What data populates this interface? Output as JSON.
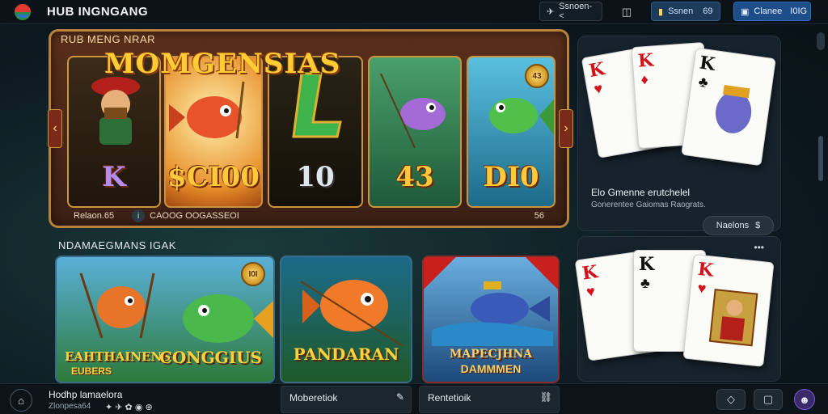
{
  "header": {
    "title": "HUB INGNGANG",
    "logo_icon": "colorful-ball-logo",
    "nav_button_1": "Ssnoen-<",
    "nav_button_2_label": "Ssnen",
    "nav_button_2_value": "69",
    "nav_button_3_label": "Clanee",
    "nav_button_3_value": "I0IG"
  },
  "featured": {
    "heading": "RUB MENG NRAR",
    "hero_title": "MOMGENSIAS",
    "reels": [
      {
        "label": "K",
        "art": "pirate-character"
      },
      {
        "label": "$CI00",
        "art": "red-fish-with-fork"
      },
      {
        "label": "10",
        "art": "green-letter-L"
      },
      {
        "label": "43",
        "art": "purple-fish-with-rod"
      },
      {
        "label": "DI0",
        "art": "green-fish-jumping"
      }
    ],
    "corner_coin": "43",
    "footer_left": "Relaon.65",
    "footer_mid": "CAOOG OOGASSEOI",
    "footer_right": "56"
  },
  "side_card_top": {
    "title": "Elo Gmenne erutchelel",
    "subtitle": "Gonerentee Gaiomas Raograts.",
    "button": "Naelons",
    "cards": [
      {
        "rank": "K",
        "suit": "♥",
        "color": "red"
      },
      {
        "rank": "K",
        "suit": "♦",
        "color": "red"
      },
      {
        "rank": "K",
        "suit": "♣",
        "color": "black"
      }
    ]
  },
  "lower": {
    "title": "NDAMAEGMANS IGAK",
    "more": "•••",
    "tiles": [
      {
        "name": "EAHTHAINENS",
        "sub": "EUBERS",
        "coin": "I0I",
        "art": "orange-fish-with-rods"
      },
      {
        "name": "CONGGIUS",
        "sub": "",
        "art": "green-fish"
      },
      {
        "name": "PANDARAN",
        "sub": "",
        "art": "orange-fish-with-rod"
      },
      {
        "name": "MAPECJHNA",
        "sub": "DAMMMEN",
        "art": "blue-shark-in-water"
      }
    ],
    "cards": [
      {
        "rank": "K",
        "suit": "♥",
        "color": "red"
      },
      {
        "rank": "K",
        "suit": "♣",
        "color": "black"
      },
      {
        "rank": "K",
        "suit": "♥",
        "color": "red"
      }
    ]
  },
  "footer": {
    "left_title": "Hodhp lamaelora",
    "left_sub": "Zlonpesa64",
    "tab_1": "Moberetiok",
    "tab_2": "Rentetioik",
    "right_icons": [
      "diamond-icon",
      "chat-icon",
      "user-avatar-icon"
    ]
  },
  "colors": {
    "gold": "#ffc93a",
    "frame": "#b8823a",
    "accent_blue": "#1d4e8a",
    "panel_dark": "#16222c"
  }
}
